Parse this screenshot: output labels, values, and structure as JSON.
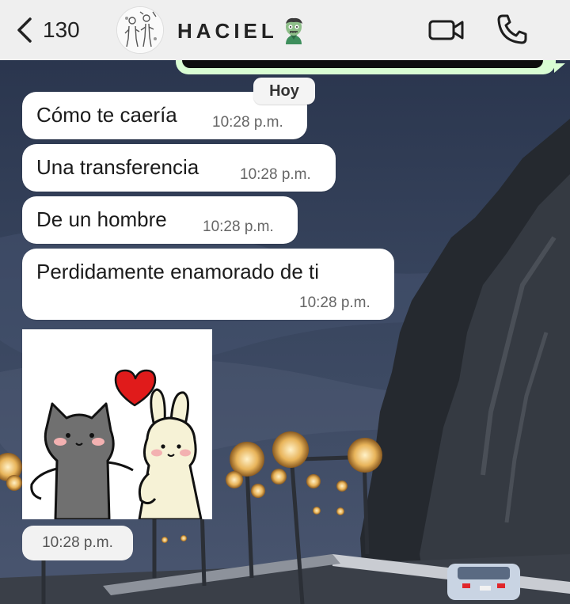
{
  "header": {
    "back_count": "130",
    "contact_name": "HACIEL",
    "contact_emoji": "zombie-emoji"
  },
  "chat": {
    "date_label": "Hoy",
    "messages": [
      {
        "text": "Cómo te caería",
        "time": "10:28 p.m."
      },
      {
        "text": "Una transferencia",
        "time": "10:28 p.m."
      },
      {
        "text": "De un hombre",
        "time": "10:28 p.m."
      },
      {
        "text": "Perdidamente enamorado de ti",
        "time": "10:28 p.m."
      }
    ],
    "sticker": {
      "description_icon": "cat-and-bunny-heart-sticker",
      "time": "10:28 p.m."
    }
  },
  "icons": {
    "back": "chevron-left-icon",
    "video": "video-camera-icon",
    "call": "phone-icon"
  },
  "colors": {
    "header_bg": "#efefef",
    "incoming_bubble": "#ffffff",
    "outgoing_bubble": "#d9fdd3",
    "heart": "#e01b1b"
  }
}
